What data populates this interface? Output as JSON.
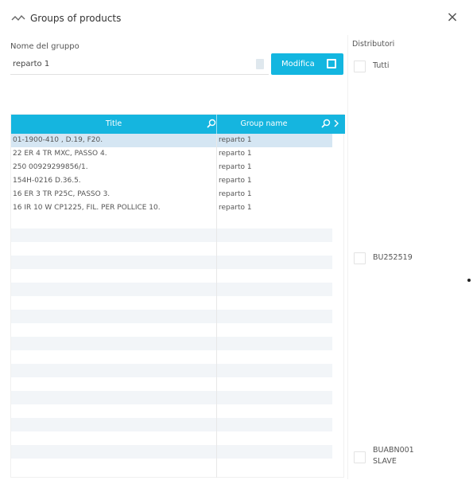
{
  "window": {
    "title": "Groups of products",
    "close_glyph": "×",
    "title_icon": "groups-icon"
  },
  "form": {
    "group_name_label": "Nome del gruppo",
    "group_name_value": "reparto 1",
    "modify_label": "Modifica"
  },
  "table": {
    "columns": [
      "Title",
      "Group name"
    ],
    "rows": [
      {
        "title": "01-1900-410 , D.19, F20.",
        "group": "reparto 1",
        "selected": true
      },
      {
        "title": "22 ER 4 TR MXC, PASSO 4.",
        "group": "reparto 1"
      },
      {
        "title": "250 00929299856/1.",
        "group": "reparto 1"
      },
      {
        "title": "154H-0216 D.36.5.",
        "group": "reparto 1"
      },
      {
        "title": "16 ER 3 TR P25C, PASSO 3.",
        "group": "reparto 1"
      },
      {
        "title": "16 IR 10 W CP1225, FIL. PER POLLICE 10.",
        "group": "reparto 1"
      }
    ]
  },
  "distributors": {
    "label": "Distributori",
    "items": [
      {
        "label": "Tutti"
      },
      {
        "label": "BU252519"
      },
      {
        "label": "BUABN001 SLAVE"
      }
    ]
  }
}
